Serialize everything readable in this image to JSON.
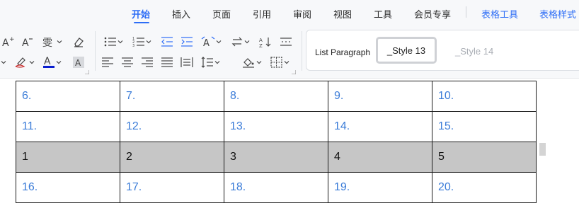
{
  "tabs": [
    {
      "label": "开始",
      "active": true
    },
    {
      "label": "插入"
    },
    {
      "label": "页面"
    },
    {
      "label": "引用"
    },
    {
      "label": "审阅"
    },
    {
      "label": "视图"
    },
    {
      "label": "工具"
    },
    {
      "label": "会员专享"
    },
    {
      "label": "表格工具",
      "accent": true
    },
    {
      "label": "表格样式",
      "accent": true
    }
  ],
  "ribbon": {
    "font_group": {
      "row1": [
        "increase-font-icon",
        "decrease-font-icon",
        "phonetic-guide-icon",
        "clear-format-icon"
      ],
      "row2": [
        "highlight-icon",
        "font-color-icon",
        "character-shading-icon"
      ],
      "font_color": "#0a1ecf"
    },
    "paragraph_group": {
      "row1": [
        "bullets-icon",
        "numbering-icon",
        "decrease-indent-icon",
        "increase-indent-icon",
        "text-direction-icon",
        "sort-icon",
        "distributed-icon"
      ],
      "row2": [
        "align-left-icon",
        "align-center-icon",
        "align-right-icon",
        "justify-icon",
        "distributed-align-icon",
        "line-spacing-icon",
        "shading-icon",
        "borders-icon"
      ]
    },
    "styles": {
      "plain": "List Paragraph",
      "selected": "_Style 13",
      "light": "_Style 14"
    }
  },
  "table": {
    "rows": [
      {
        "cells": [
          "6.",
          "7.",
          "8.",
          "9.",
          "10."
        ],
        "highlighted": false
      },
      {
        "cells": [
          "11.",
          "12.",
          "13.",
          "14.",
          "15."
        ],
        "highlighted": false
      },
      {
        "cells": [
          "1",
          "2",
          "3",
          "4",
          "5"
        ],
        "highlighted": true
      },
      {
        "cells": [
          "16.",
          "17.",
          "18.",
          "19.",
          "20."
        ],
        "highlighted": false
      }
    ]
  },
  "colors": {
    "accent": "#2d6df6",
    "list_number_text": "#3b7cd8",
    "highlight_row": "#c6c6c6"
  }
}
